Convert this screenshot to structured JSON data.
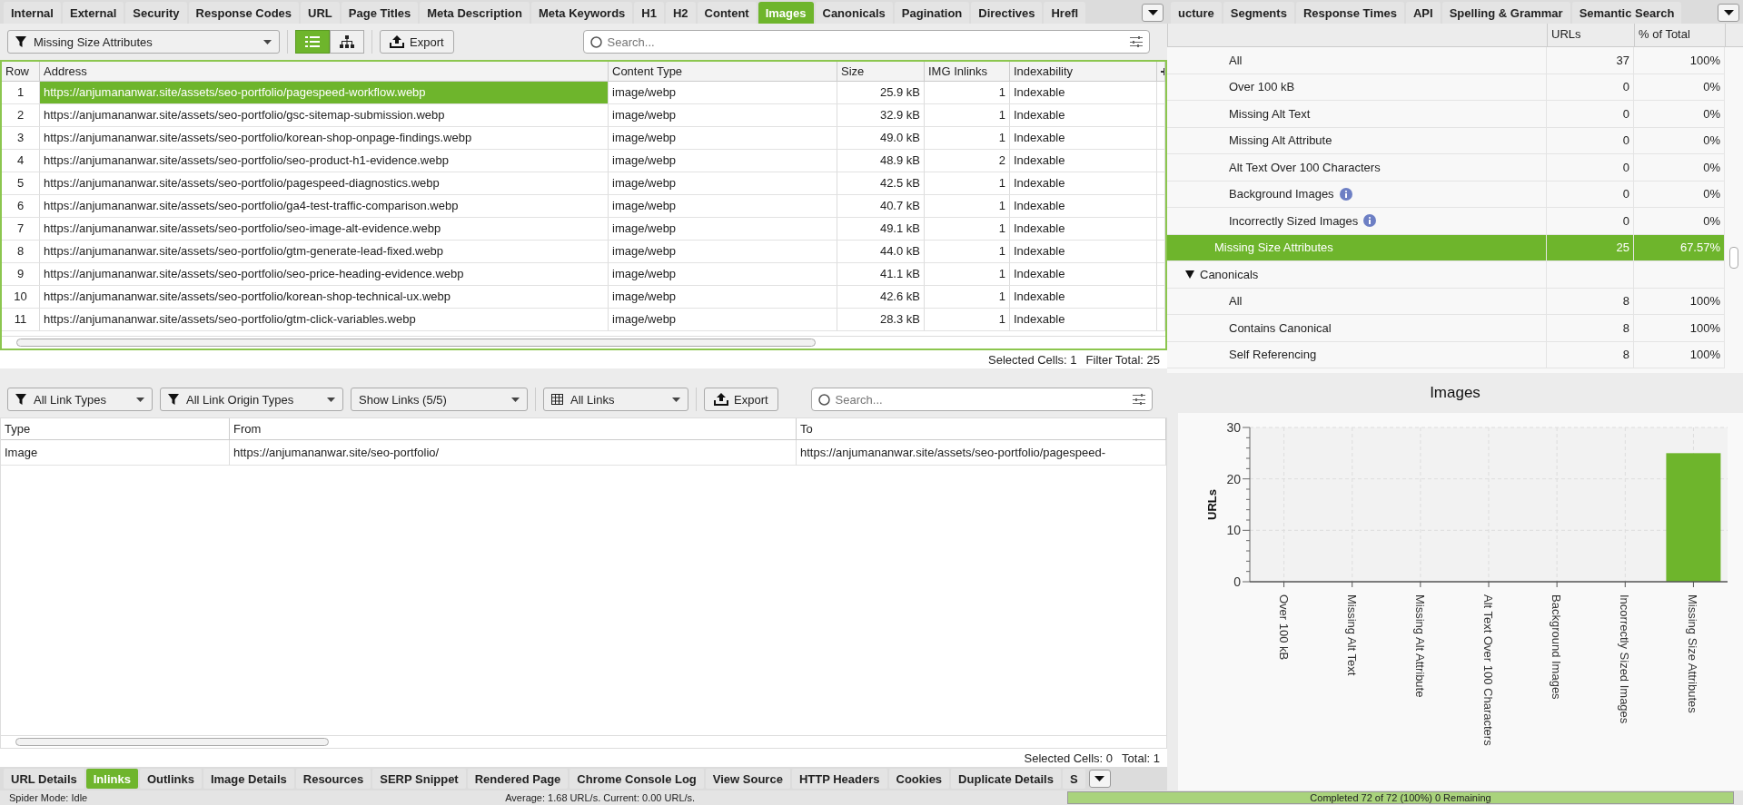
{
  "top_tabs": [
    {
      "label": "Internal",
      "selected": false
    },
    {
      "label": "External",
      "selected": false
    },
    {
      "label": "Security",
      "selected": false
    },
    {
      "label": "Response Codes",
      "selected": false
    },
    {
      "label": "URL",
      "selected": false
    },
    {
      "label": "Page Titles",
      "selected": false
    },
    {
      "label": "Meta Description",
      "selected": false
    },
    {
      "label": "Meta Keywords",
      "selected": false
    },
    {
      "label": "H1",
      "selected": false
    },
    {
      "label": "H2",
      "selected": false
    },
    {
      "label": "Content",
      "selected": false
    },
    {
      "label": "Images",
      "selected": true
    },
    {
      "label": "Canonicals",
      "selected": false
    },
    {
      "label": "Pagination",
      "selected": false
    },
    {
      "label": "Directives",
      "selected": false
    },
    {
      "label": "Hrefl",
      "selected": false
    }
  ],
  "toolbar": {
    "filter": "Missing Size Attributes",
    "list_view_selected": true,
    "export": "Export",
    "search": {
      "placeholder": "Search..."
    }
  },
  "table": {
    "columns": [
      "Row",
      "Address",
      "Content Type",
      "Size",
      "IMG Inlinks",
      "Indexability"
    ],
    "rows": [
      {
        "cells": [
          "1",
          "https://anjumananwar.site/assets/seo-portfolio/pagespeed-workflow.webp",
          "image/webp",
          "25.9 kB",
          "1",
          "Indexable"
        ],
        "selected": true
      },
      {
        "cells": [
          "2",
          "https://anjumananwar.site/assets/seo-portfolio/gsc-sitemap-submission.webp",
          "image/webp",
          "32.9 kB",
          "1",
          "Indexable"
        ],
        "selected": false
      },
      {
        "cells": [
          "3",
          "https://anjumananwar.site/assets/seo-portfolio/korean-shop-onpage-findings.webp",
          "image/webp",
          "49.0 kB",
          "1",
          "Indexable"
        ],
        "selected": false
      },
      {
        "cells": [
          "4",
          "https://anjumananwar.site/assets/seo-portfolio/seo-product-h1-evidence.webp",
          "image/webp",
          "48.9 kB",
          "2",
          "Indexable"
        ],
        "selected": false
      },
      {
        "cells": [
          "5",
          "https://anjumananwar.site/assets/seo-portfolio/pagespeed-diagnostics.webp",
          "image/webp",
          "42.5 kB",
          "1",
          "Indexable"
        ],
        "selected": false
      },
      {
        "cells": [
          "6",
          "https://anjumananwar.site/assets/seo-portfolio/ga4-test-traffic-comparison.webp",
          "image/webp",
          "40.7 kB",
          "1",
          "Indexable"
        ],
        "selected": false
      },
      {
        "cells": [
          "7",
          "https://anjumananwar.site/assets/seo-portfolio/seo-image-alt-evidence.webp",
          "image/webp",
          "49.1 kB",
          "1",
          "Indexable"
        ],
        "selected": false
      },
      {
        "cells": [
          "8",
          "https://anjumananwar.site/assets/seo-portfolio/gtm-generate-lead-fixed.webp",
          "image/webp",
          "44.0 kB",
          "1",
          "Indexable"
        ],
        "selected": false
      },
      {
        "cells": [
          "9",
          "https://anjumananwar.site/assets/seo-portfolio/seo-price-heading-evidence.webp",
          "image/webp",
          "41.1 kB",
          "1",
          "Indexable"
        ],
        "selected": false
      },
      {
        "cells": [
          "10",
          "https://anjumananwar.site/assets/seo-portfolio/korean-shop-technical-ux.webp",
          "image/webp",
          "42.6 kB",
          "1",
          "Indexable"
        ],
        "selected": false
      },
      {
        "cells": [
          "11",
          "https://anjumananwar.site/assets/seo-portfolio/gtm-click-variables.webp",
          "image/webp",
          "28.3 kB",
          "1",
          "Indexable"
        ],
        "selected": false
      }
    ],
    "status": [
      "Selected Cells: 1",
      "Filter Total: 25"
    ]
  },
  "lower_toolbar": {
    "dropdowns": [
      {
        "label": "All Link Types",
        "kind": "filter"
      },
      {
        "label": "All Link Origin Types",
        "kind": "filter"
      },
      {
        "label": "Show Links (5/5)",
        "kind": "plain"
      },
      {
        "label": "All Links",
        "kind": "table"
      }
    ],
    "export": "Export",
    "search": {
      "placeholder": "Search..."
    }
  },
  "lower_table": {
    "columns": [
      "Type",
      "From",
      "To"
    ],
    "rows": [
      [
        "Image",
        "https://anjumananwar.site/seo-portfolio/",
        "https://anjumananwar.site/assets/seo-portfolio/pagespeed-"
      ]
    ],
    "status": [
      "Selected Cells: 0",
      "Total: 1"
    ]
  },
  "bottom_tabs": [
    {
      "label": "URL Details",
      "selected": false
    },
    {
      "label": "Inlinks",
      "selected": true
    },
    {
      "label": "Outlinks",
      "selected": false
    },
    {
      "label": "Image Details",
      "selected": false
    },
    {
      "label": "Resources",
      "selected": false
    },
    {
      "label": "SERP Snippet",
      "selected": false
    },
    {
      "label": "Rendered Page",
      "selected": false
    },
    {
      "label": "Chrome Console Log",
      "selected": false
    },
    {
      "label": "View Source",
      "selected": false
    },
    {
      "label": "HTTP Headers",
      "selected": false
    },
    {
      "label": "Cookies",
      "selected": false
    },
    {
      "label": "Duplicate Details",
      "selected": false
    },
    {
      "label": "S",
      "selected": false
    }
  ],
  "right_tabs": [
    {
      "label": "ucture",
      "selected": false
    },
    {
      "label": "Segments",
      "selected": false
    },
    {
      "label": "Response Times",
      "selected": false
    },
    {
      "label": "API",
      "selected": false
    },
    {
      "label": "Spelling & Grammar",
      "selected": false
    },
    {
      "label": "Semantic Search",
      "selected": false
    }
  ],
  "overview": {
    "columns": [
      "URLs",
      "% of Total"
    ],
    "continued_rows": [
      {
        "label": "All",
        "urls": "37",
        "percent": "100%",
        "info": false,
        "selected": false
      },
      {
        "label": "Over 100 kB",
        "urls": "0",
        "percent": "0%",
        "info": false,
        "selected": false
      },
      {
        "label": "Missing Alt Text",
        "urls": "0",
        "percent": "0%",
        "info": false,
        "selected": false
      },
      {
        "label": "Missing Alt Attribute",
        "urls": "0",
        "percent": "0%",
        "info": false,
        "selected": false
      },
      {
        "label": "Alt Text Over 100 Characters",
        "urls": "0",
        "percent": "0%",
        "info": false,
        "selected": false
      },
      {
        "label": "Background Images",
        "urls": "0",
        "percent": "0%",
        "info": true,
        "selected": false
      },
      {
        "label": "Incorrectly Sized Images",
        "urls": "0",
        "percent": "0%",
        "info": true,
        "selected": false
      },
      {
        "label": "Missing Size Attributes",
        "urls": "25",
        "percent": "67.57%",
        "info": false,
        "selected": true
      }
    ],
    "groups": [
      {
        "label": "Canonicals",
        "expanded": true,
        "children": [
          {
            "label": "All",
            "urls": "8",
            "percent": "100%",
            "info": false,
            "selected": false
          },
          {
            "label": "Contains Canonical",
            "urls": "8",
            "percent": "100%",
            "info": false,
            "selected": false
          },
          {
            "label": "Self Referencing",
            "urls": "8",
            "percent": "100%",
            "info": false,
            "selected": false
          }
        ]
      }
    ]
  },
  "chart": {
    "chart_data": {
      "type": "bar",
      "title": "Images",
      "ylabel": "URLs",
      "categories": [
        "Over 100 kB",
        "Missing Alt Text",
        "Missing Alt Attribute",
        "Alt Text Over 100 Characters",
        "Background Images",
        "Incorrectly Sized Images",
        "Missing Size Attributes"
      ],
      "values": [
        0,
        0,
        0,
        0,
        0,
        0,
        25
      ],
      "ylim": [
        0,
        30
      ],
      "yticks": [
        0,
        10,
        20,
        30
      ],
      "grid": true
    }
  },
  "status_bar": {
    "mode": "Spider Mode: Idle",
    "speed": "Average: 1.68 URL/s. Current: 0.00 URL/s.",
    "progress": {
      "text": "Completed 72 of 72 (100%) 0 Remaining",
      "level": 1
    }
  }
}
